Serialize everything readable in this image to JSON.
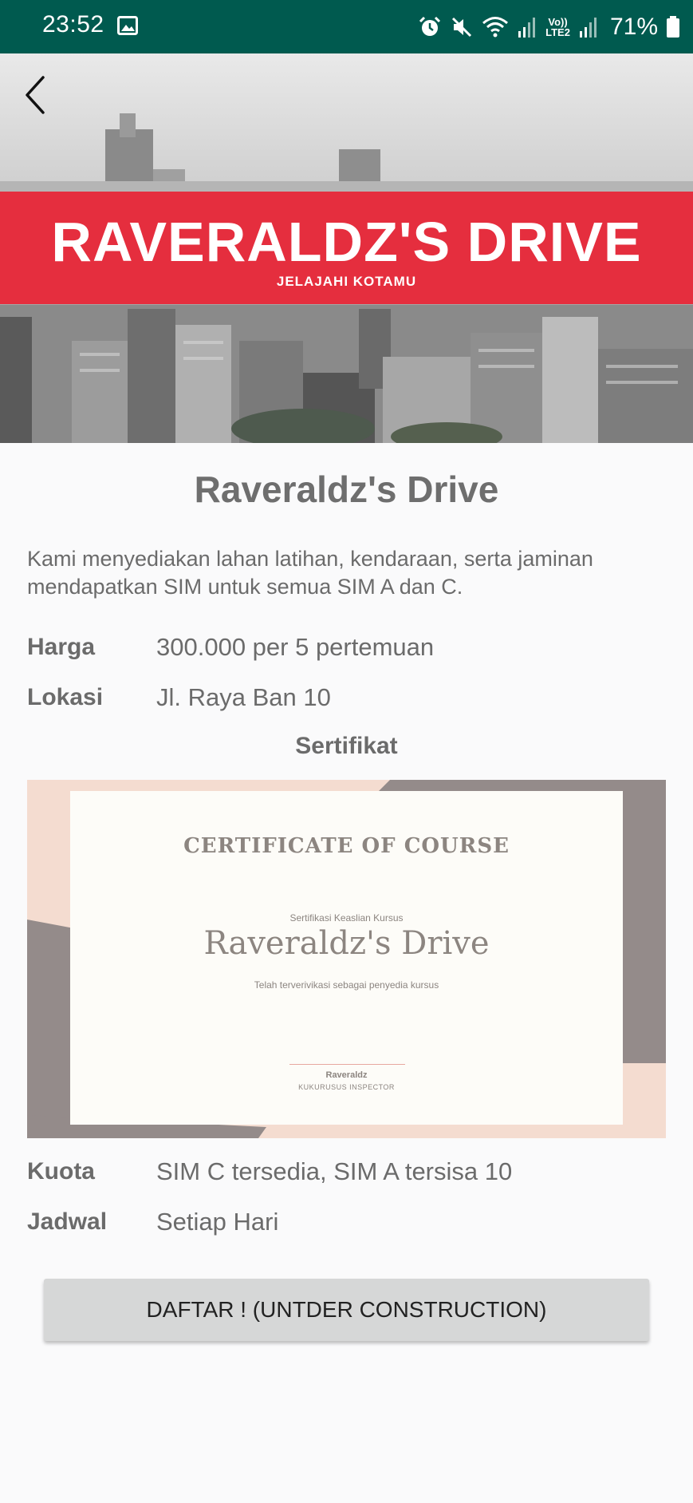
{
  "status_bar": {
    "time": "23:52",
    "battery": "71%",
    "icons": [
      "gallery-icon",
      "alarm-icon",
      "mute-icon",
      "wifi-icon",
      "signal-icon",
      "volte-icon",
      "battery-icon"
    ],
    "volte_label_top": "Vo))",
    "volte_label_bottom": "LTE2"
  },
  "banner": {
    "brand": "RAVERALDZ'S DRIVE",
    "tagline": "JELAJAHI KOTAMU",
    "accent_color": "#e52e3e"
  },
  "details": {
    "title": "Raveraldz's Drive",
    "description": "Kami menyediakan lahan latihan, kendaraan, serta jaminan mendapatkan SIM untuk semua SIM A dan C.",
    "price_label": "Harga",
    "price_value": "300.000 per 5 pertemuan",
    "location_label": "Lokasi",
    "location_value": "Jl. Raya Ban 10",
    "certificate_heading": "Sertifikat",
    "quota_label": "Kuota",
    "quota_value": "SIM C tersedia, SIM A tersisa 10",
    "schedule_label": "Jadwal",
    "schedule_value": "Setiap Hari"
  },
  "certificate": {
    "title": "CERTIFICATE OF COURSE",
    "subtitle": "Sertifikasi Keaslian Kursus",
    "name": "Raveraldz's Drive",
    "verified": "Telah terverivikasi sebagai penyedia kursus",
    "signer": "Raveraldz",
    "signer_role": "KUKURUSUS INSPECTOR"
  },
  "actions": {
    "register_label": "DAFTAR ! (UNTDER CONSTRUCTION)"
  }
}
